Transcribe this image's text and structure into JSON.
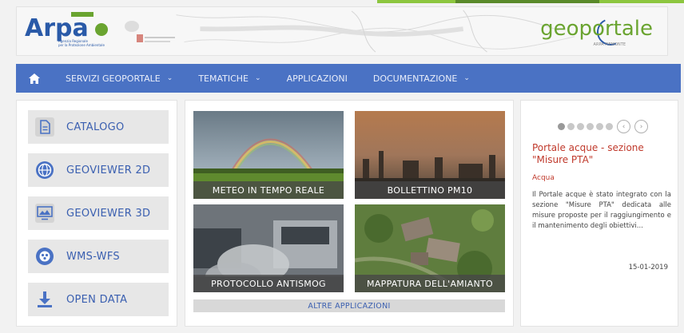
{
  "header": {
    "arpa_logo_text": "Arpa",
    "arpa_sub": "Agenzia Regionale per la Protezione Ambientale",
    "geoportale_text": "geoportale",
    "geoportale_sub": "ARPA PIEMONTE"
  },
  "nav": {
    "home_icon": "home-icon",
    "items": [
      {
        "label": "SERVIZI GEOPORTALE",
        "has_caret": true
      },
      {
        "label": "TEMATICHE",
        "has_caret": true
      },
      {
        "label": "APPLICAZIONI",
        "has_caret": false
      },
      {
        "label": "DOCUMENTAZIONE",
        "has_caret": true
      }
    ],
    "caret": "⌄"
  },
  "sidebar": {
    "items": [
      {
        "label": "CATALOGO",
        "icon": "document-icon"
      },
      {
        "label": "GEOVIEWER 2D",
        "icon": "globe-icon"
      },
      {
        "label": "GEOVIEWER 3D",
        "icon": "monitor-icon"
      },
      {
        "label": "WMS-WFS",
        "icon": "service-icon"
      },
      {
        "label": "OPEN DATA",
        "icon": "download-icon"
      }
    ]
  },
  "tiles": [
    {
      "label": "METEO IN TEMPO REALE"
    },
    {
      "label": "BOLLETTINO PM10"
    },
    {
      "label": "PROTOCOLLO ANTISMOG"
    },
    {
      "label": "MAPPATURA DELL'AMIANTO"
    }
  ],
  "more_apps": "ALTRE APPLICAZIONI",
  "news": {
    "title": "Portale acque - sezione \"Misure PTA\"",
    "category": "Acqua",
    "body": "Il Portale acque è stato integrato con la sezione \"Misure PTA\" dedicata alle misure proposte per il raggiungimento e il mantenimento degli obiettivi...",
    "date": "15-01-2019",
    "prev_icon": "‹",
    "next_icon": "›"
  },
  "colors": {
    "nav_bg": "#4a72c4",
    "accent_blue": "#3a5fb0",
    "news_red": "#c0392b",
    "brand_green": "#6aa430"
  }
}
